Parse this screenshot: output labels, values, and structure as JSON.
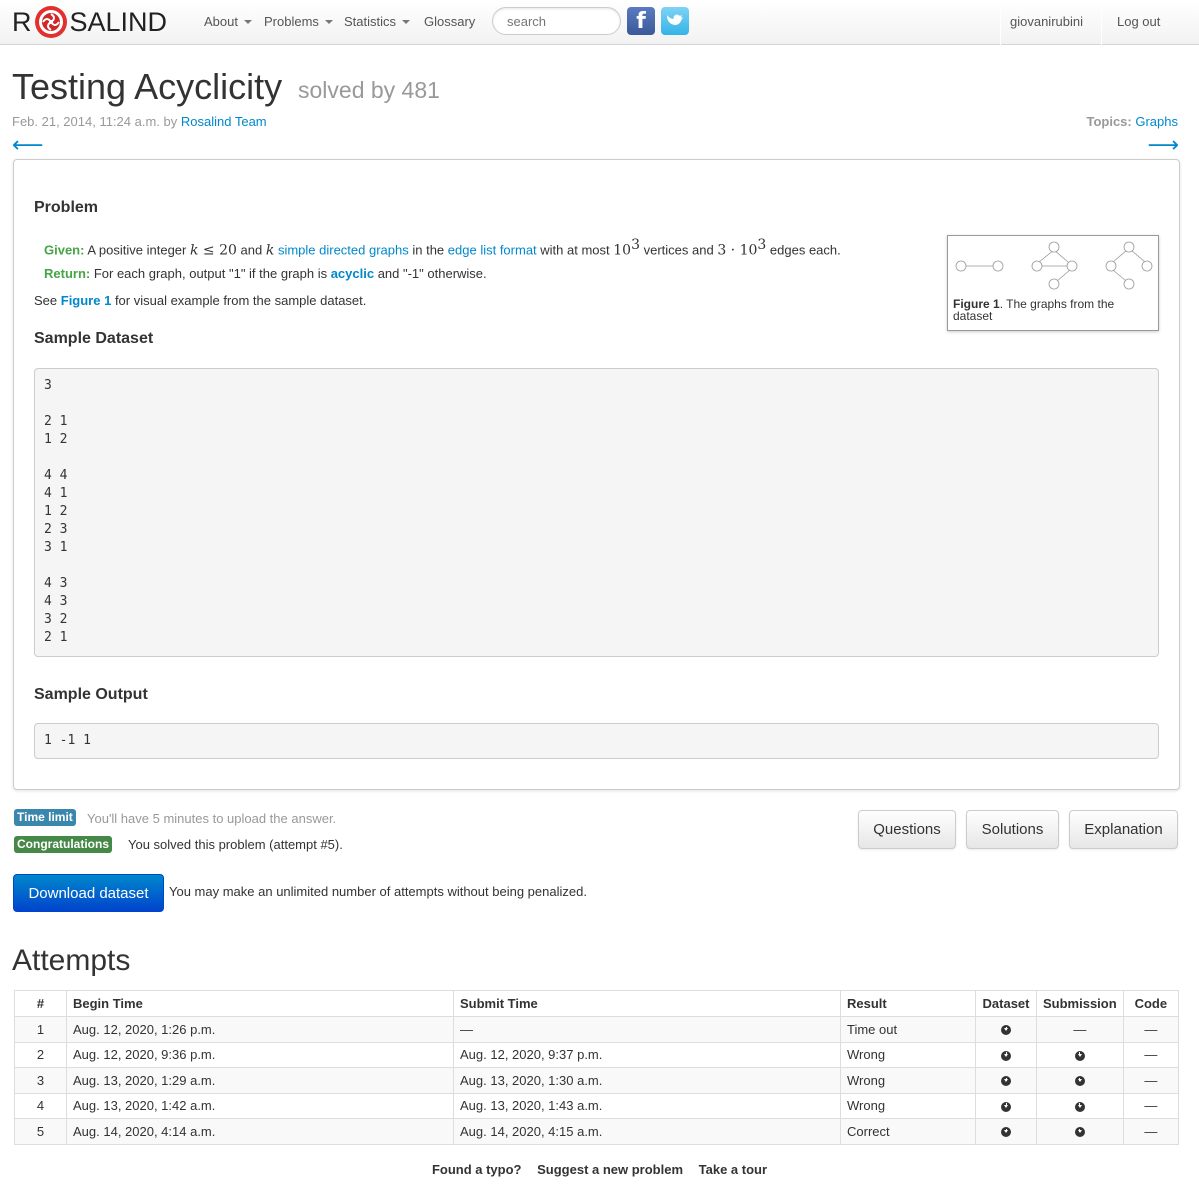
{
  "nav": {
    "logo_left": "R",
    "logo_right": "SALIND",
    "items": [
      "About",
      "Problems",
      "Statistics",
      "Glossary"
    ],
    "search_placeholder": "search",
    "user": "giovanirubini",
    "logout": "Log out",
    "facebook_icon": "f"
  },
  "header": {
    "title": "Testing Acyclicity",
    "solved": "solved by 481",
    "date": "Feb. 21, 2014, 11:24 a.m. by ",
    "author": "Rosalind Team",
    "topics_label": "Topics:",
    "topic": "Graphs",
    "prev_arrow": "⟵",
    "next_arrow": "⟶"
  },
  "problem": {
    "heading": "Problem",
    "given_label": "Given:",
    "given_1": " A positive integer ",
    "given_k": "k",
    "given_leq": " ≤ 20",
    "given_and": " and ",
    "given_k2": "k",
    "given_sdg": "simple directed graphs",
    "given_in": " in the ",
    "given_elf": "edge list format",
    "given_with": " with at most ",
    "given_10": "10",
    "given_exp": "3",
    "given_vertices": " vertices and ",
    "given_3dot10": "3 · 10",
    "given_exp2": "3",
    "given_edges": " edges each.",
    "return_label": "Return:",
    "return_1": " For each graph, output \"1\" if the graph is ",
    "return_acyclic": "acyclic",
    "return_2": " and \"-1\" otherwise.",
    "see_1": "See ",
    "see_fig": "Figure 1",
    "see_2": " for visual example from the sample dataset.",
    "figure_label": "Figure 1",
    "figure_caption": ". The graphs from the dataset",
    "sample_dataset_heading": "Sample Dataset",
    "sample_dataset_lines": [
      "3",
      "",
      "2 1",
      "1 2",
      "",
      "4 4",
      "4 1",
      "1 2",
      "2 3",
      "3 1",
      "",
      "4 3",
      "4 3",
      "3 2",
      "2 1"
    ],
    "sample_output_heading": "Sample Output",
    "sample_output": "1 -1 1"
  },
  "status": {
    "time_limit_label": "Time limit",
    "time_limit_text": "You'll have 5 minutes to upload the answer.",
    "congrats_label": "Congratulations",
    "congrats_text": "You solved this problem (attempt #5).",
    "download_button": "Download dataset",
    "download_note": "You may make an unlimited number of attempts without being penalized.",
    "buttons": [
      "Questions",
      "Solutions",
      "Explanation"
    ]
  },
  "attempts": {
    "heading": "Attempts",
    "columns": [
      "#",
      "Begin Time",
      "Submit Time",
      "Result",
      "Dataset",
      "Submission",
      "Code"
    ],
    "rows": [
      {
        "n": "1",
        "begin": "Aug. 12, 2020, 1:26 p.m.",
        "submit": "—",
        "result": "Time out",
        "dataset": true,
        "submission": false,
        "code": "—",
        "submission_text": "—"
      },
      {
        "n": "2",
        "begin": "Aug. 12, 2020, 9:36 p.m.",
        "submit": "Aug. 12, 2020, 9:37 p.m.",
        "result": "Wrong",
        "dataset": true,
        "submission": true,
        "code": "—",
        "submission_text": ""
      },
      {
        "n": "3",
        "begin": "Aug. 13, 2020, 1:29 a.m.",
        "submit": "Aug. 13, 2020, 1:30 a.m.",
        "result": "Wrong",
        "dataset": true,
        "submission": true,
        "code": "—",
        "submission_text": ""
      },
      {
        "n": "4",
        "begin": "Aug. 13, 2020, 1:42 a.m.",
        "submit": "Aug. 13, 2020, 1:43 a.m.",
        "result": "Wrong",
        "dataset": true,
        "submission": true,
        "code": "—",
        "submission_text": ""
      },
      {
        "n": "5",
        "begin": "Aug. 14, 2020, 4:14 a.m.",
        "submit": "Aug. 14, 2020, 4:15 a.m.",
        "result": "Correct",
        "dataset": true,
        "submission": true,
        "code": "—",
        "submission_text": ""
      }
    ]
  },
  "footer": [
    "Found a typo?",
    "Suggest a new problem",
    "Take a tour"
  ],
  "colors": {
    "link": "#0088cc",
    "green": "#46a546",
    "primary": "#0044cc"
  }
}
